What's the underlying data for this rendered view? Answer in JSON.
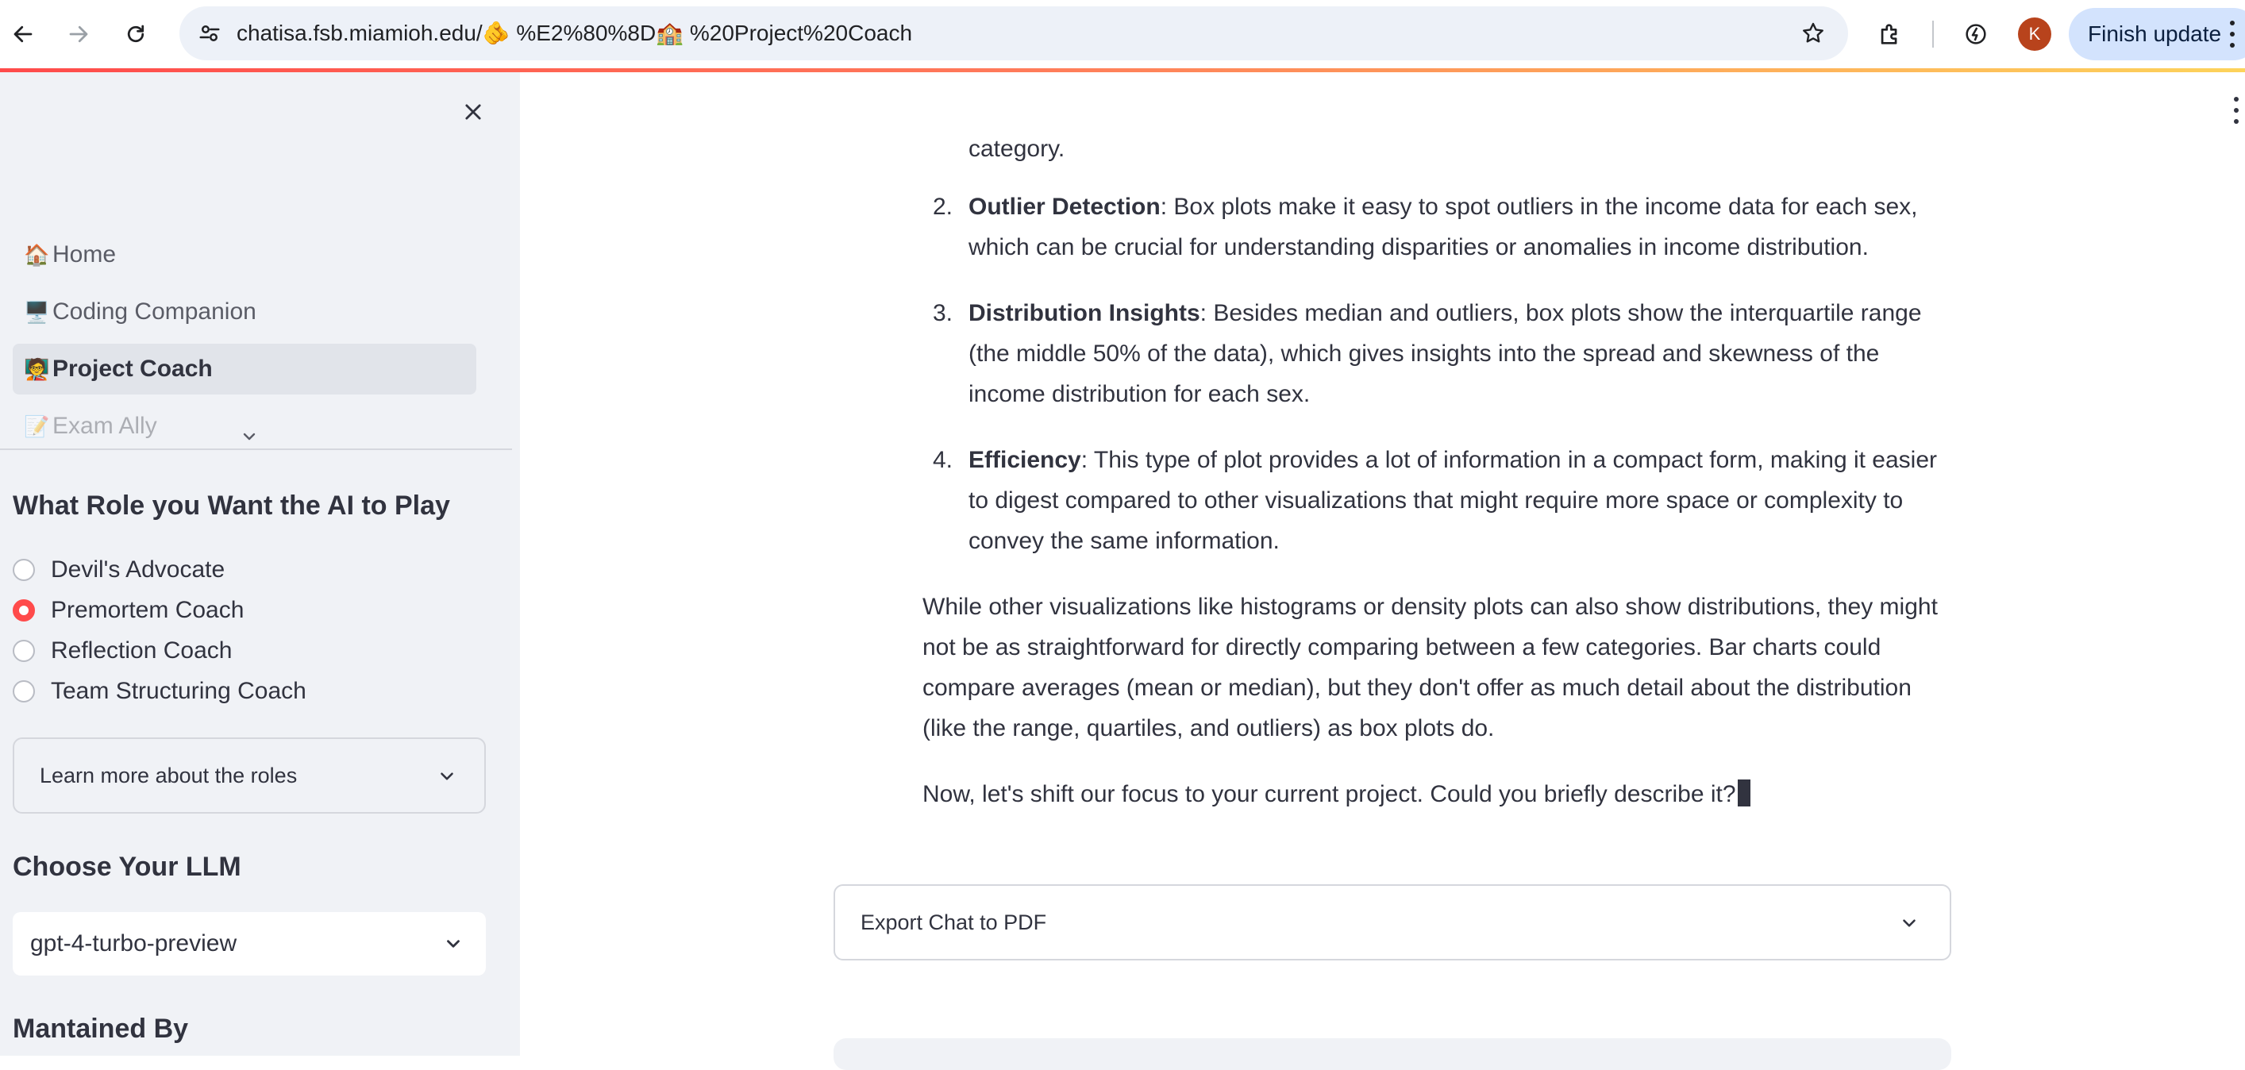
{
  "browser": {
    "url": "chatisa.fsb.miamioh.edu/🫵 %E2%80%8D🏫 %20Project%20Coach",
    "finish_update_label": "Finish update",
    "profile_initial": "K",
    "icons": [
      "back-arrow-icon",
      "forward-arrow-icon",
      "reload-icon",
      "site-settings-icon",
      "star-icon",
      "extensions-icon",
      "performance-icon",
      "kebab-menu-icon"
    ]
  },
  "sidebar": {
    "nav": [
      {
        "emoji": "🏠",
        "label": "Home"
      },
      {
        "emoji": "🖥️",
        "label": "Coding Companion"
      },
      {
        "emoji": "🧑‍🏫",
        "label": "Project Coach",
        "active": true
      },
      {
        "emoji": "📝",
        "label": "Exam Ally"
      }
    ],
    "role_title": "What Role you Want the AI to Play",
    "roles": [
      {
        "label": "Devil's Advocate",
        "selected": false
      },
      {
        "label": "Premortem Coach",
        "selected": true
      },
      {
        "label": "Reflection Coach",
        "selected": false
      },
      {
        "label": "Team Structuring Coach",
        "selected": false
      }
    ],
    "learn_more_label": "Learn more about the roles",
    "llm_title": "Choose Your LLM",
    "llm_value": "gpt-4-turbo-preview",
    "maintained_title": "Mantained By"
  },
  "chat": {
    "fragment": "category.",
    "items": [
      {
        "num": "2.",
        "bold": "Outlier Detection",
        "text": ": Box plots make it easy to spot outliers in the income data for each sex, which can be crucial for understanding disparities or anomalies in income distribution."
      },
      {
        "num": "3.",
        "bold": "Distribution Insights",
        "text": ": Besides median and outliers, box plots show the interquartile range (the middle 50% of the data), which gives insights into the spread and skewness of the income distribution for each sex."
      },
      {
        "num": "4.",
        "bold": "Efficiency",
        "text": ": This type of plot provides a lot of information in a compact form, making it easier to digest compared to other visualizations that might require more space or complexity to convey the same information."
      }
    ],
    "paragraph": "While other visualizations like histograms or density plots can also show distributions, they might not be as straightforward for directly comparing between a few categories. Bar charts could compare averages (mean or median), but they don't offer as much detail about the distribution (like the range, quartiles, and outliers) as box plots do.",
    "question": "Now, let's shift our focus to your current project. Could you briefly describe it?"
  },
  "export_label": "Export Chat to PDF",
  "colors": {
    "accent": "#ff4b4b",
    "sidebar_bg": "#f0f2f6",
    "text": "#31333f",
    "finish_update_bg": "#d3e3fd",
    "avatar": "#b8431c"
  }
}
